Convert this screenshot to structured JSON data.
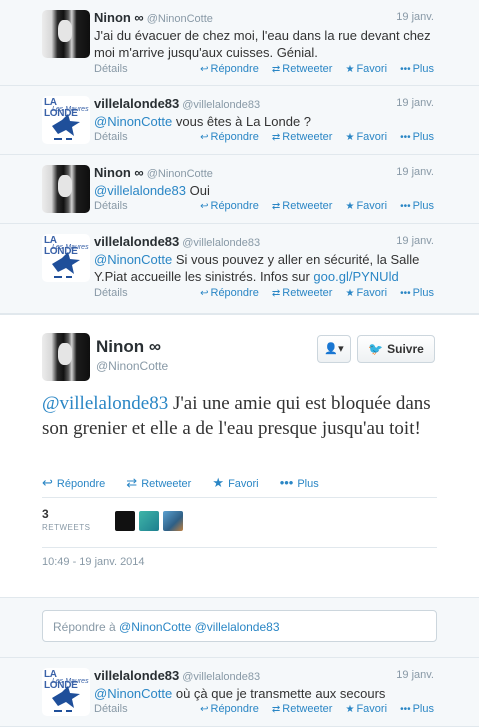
{
  "tweets_before": [
    {
      "avatar": "ninon-avatar",
      "name": "Ninon ∞",
      "handle": "@NinonCotte",
      "date": "19 janv.",
      "text_parts": [
        {
          "t": "J'ai du évacuer de chez moi, l'eau dans la rue devant chez moi m'arrive jusqu'aux cuisses. Génial.",
          "k": "plain"
        }
      ],
      "details_label": "Détails",
      "actions": {
        "reply": "Répondre",
        "retweet": "Retweeter",
        "favorite": "Favori",
        "more": "Plus"
      }
    },
    {
      "avatar": "lalonde-avatar",
      "name": "villelalonde83",
      "handle": "@villelalonde83",
      "date": "19 janv.",
      "text_parts": [
        {
          "t": "@NinonCotte",
          "k": "mention"
        },
        {
          "t": " vous êtes à La Londe ?",
          "k": "plain"
        }
      ],
      "details_label": "Détails",
      "actions": {
        "reply": "Répondre",
        "retweet": "Retweeter",
        "favorite": "Favori",
        "more": "Plus"
      }
    },
    {
      "avatar": "ninon-avatar",
      "name": "Ninon ∞",
      "handle": "@NinonCotte",
      "date": "19 janv.",
      "text_parts": [
        {
          "t": "@villelalonde83",
          "k": "mention"
        },
        {
          "t": " Oui",
          "k": "plain"
        }
      ],
      "details_label": "Détails",
      "actions": {
        "reply": "Répondre",
        "retweet": "Retweeter",
        "favorite": "Favori",
        "more": "Plus"
      }
    },
    {
      "avatar": "lalonde-avatar",
      "name": "villelalonde83",
      "handle": "@villelalonde83",
      "date": "19 janv.",
      "text_parts": [
        {
          "t": "@NinonCotte",
          "k": "mention"
        },
        {
          "t": " Si vous pouvez y aller en sécurité, la Salle Y.Piat accueille les sinistrés. Infos sur ",
          "k": "plain"
        },
        {
          "t": "goo.gl/PYNUld",
          "k": "link"
        }
      ],
      "details_label": "Détails",
      "actions": {
        "reply": "Répondre",
        "retweet": "Retweeter",
        "favorite": "Favori",
        "more": "Plus"
      }
    }
  ],
  "focused": {
    "name": "Ninon ∞",
    "handle": "@NinonCotte",
    "follow_label": "Suivre",
    "text_mention": "@villelalonde83",
    "text_body": " J'ai une amie qui est bloquée dans son grenier et elle a de l'eau presque jusqu'au toit!",
    "actions": {
      "reply": "Répondre",
      "retweet": "Retweeter",
      "favorite": "Favori",
      "more": "Plus"
    },
    "retweet_count": "3",
    "retweet_label": "RETWEETS",
    "timestamp": "10:49 - 19 janv. 2014"
  },
  "reply": {
    "prefix": "Répondre à ",
    "mentions": "@NinonCotte @villelalonde83"
  },
  "tweets_after": [
    {
      "avatar": "lalonde-avatar",
      "name": "villelalonde83",
      "handle": "@villelalonde83",
      "date": "19 janv.",
      "text_parts": [
        {
          "t": "@NinonCotte",
          "k": "mention"
        },
        {
          "t": " où çà que je transmette aux secours",
          "k": "plain"
        }
      ],
      "details_label": "Détails",
      "actions": {
        "reply": "Répondre",
        "retweet": "Retweeter",
        "favorite": "Favori",
        "more": "Plus"
      }
    }
  ],
  "lalonde_logo": {
    "line1": "LA LONDE",
    "line2": "Les Maures"
  },
  "colors": {
    "link": "#2a86c5",
    "meta": "#8899a6",
    "bg": "#f5f8fa"
  },
  "icons": {
    "reply": "reply-icon",
    "retweet": "retweet-icon",
    "favorite": "star-icon",
    "more": "more-icon"
  }
}
